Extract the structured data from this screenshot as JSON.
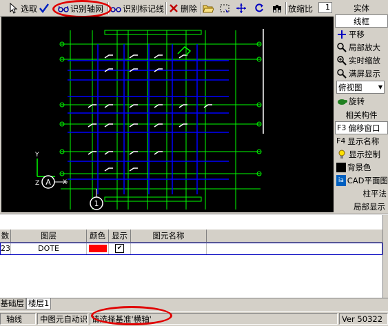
{
  "toolbar": {
    "select_label": "选取",
    "identify_axis_label": "识别轴网",
    "identify_mark_label": "识别标记线",
    "delete_label": "删除",
    "zoom_ratio_label": "放缩比",
    "zoom_value": "1"
  },
  "panel": {
    "solid_label": "实体",
    "wireframe_label": "线框",
    "pan_label": "平移",
    "zoom_local_label": "局部放大",
    "zoom_realtime_label": "实时缩放",
    "zoom_fit_label": "满屏显示",
    "view_select_value": "俯视图",
    "rotate_label": "旋转",
    "related_label": "相关构件",
    "offset_window_key": "F3",
    "offset_window_label": "偏移窗口",
    "show_name_key": "F4",
    "show_name_label": "显示名称",
    "display_control_label": "显示控制",
    "background_label": "背景色",
    "cad_plan_label": "CAD平面图",
    "column_method_label": "柱平法",
    "local_display_label": "局部显示"
  },
  "canvas": {
    "axis_bubble_a": "A",
    "axis_bubble_1": "1",
    "ucs_y": "Y",
    "ucs_z": "Z",
    "ucs_x": "X"
  },
  "grid": {
    "columns": [
      "数",
      "图层",
      "颜色",
      "显示",
      "图元名称"
    ],
    "rows": [
      {
        "count": "23",
        "layer": "DOTE",
        "color": "#ff0000",
        "show": "✔",
        "name": ""
      }
    ]
  },
  "tabs": {
    "foundation": "基础层",
    "floor1": "楼层1"
  },
  "status": {
    "axis_label": "轴线",
    "auto_recognize_text": "中图元自动识",
    "prompt_text": "请选择基准'横轴'",
    "version_text": "Ver 50322"
  },
  "colors": {
    "canvas_bg": "#000000",
    "grid_green": "#00ff00",
    "axis_blue": "#0000ff",
    "highlight_red": "#e00000"
  }
}
